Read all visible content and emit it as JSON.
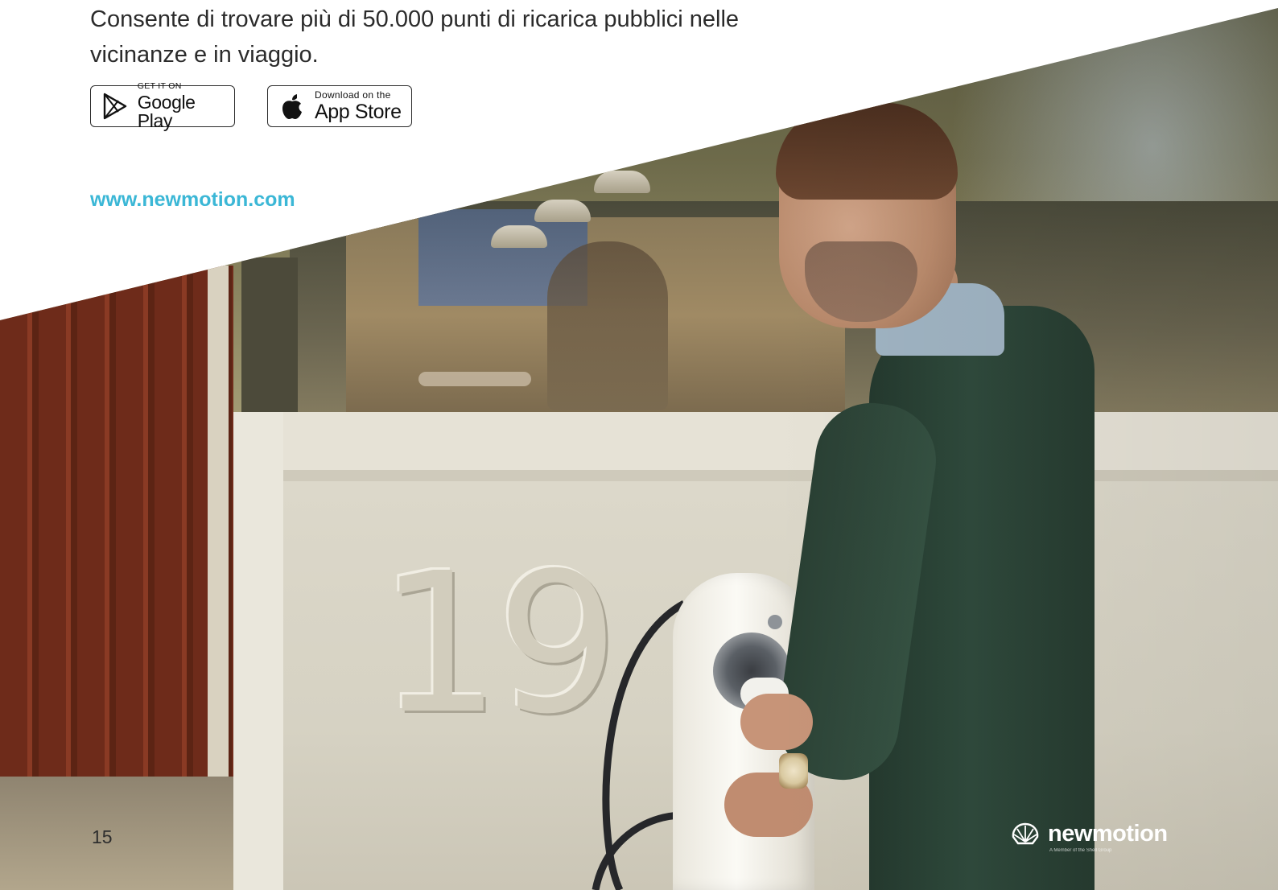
{
  "intro": {
    "line1": "Consente di trovare più di 50.000 punti di ricarica pubblici nelle",
    "line2": "vicinanze e in viaggio."
  },
  "badges": {
    "google_play": {
      "small": "GET IT ON",
      "big": "Google Play",
      "icon": "google-play-icon"
    },
    "app_store": {
      "small": "Download on the",
      "big": "App Store",
      "icon": "apple-icon"
    }
  },
  "website": "www.newmotion.com",
  "photo": {
    "house_number": "19"
  },
  "footer": {
    "page_number": "15",
    "logo_word": "newmotion",
    "logo_tagline": "A Member of the Shell Group",
    "logo_icon": "shell-icon"
  },
  "colors": {
    "link": "#3bb7d6",
    "text": "#2b2b2b"
  }
}
